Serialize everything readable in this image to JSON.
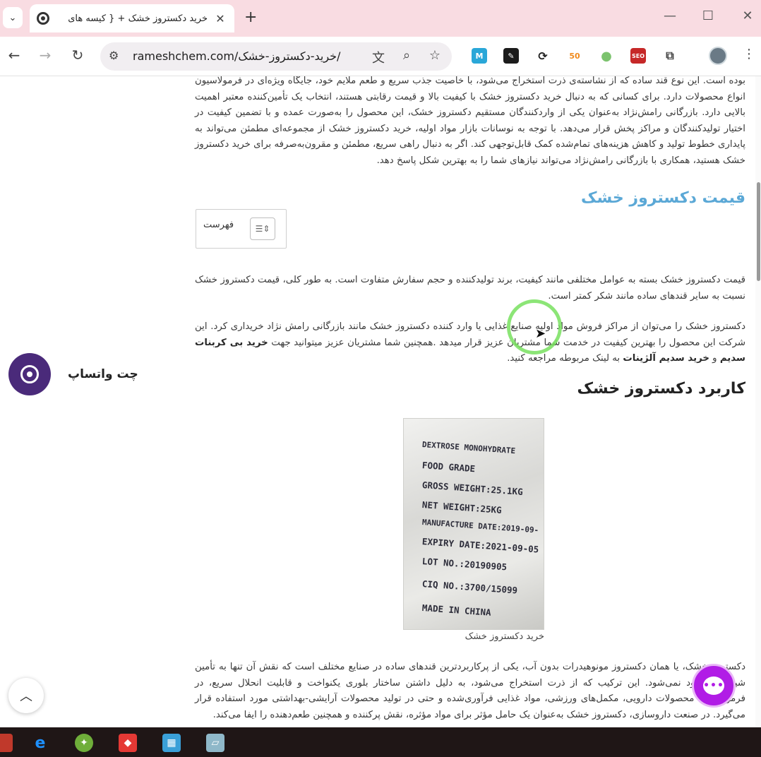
{
  "browser": {
    "tab_title": "خرید دکستروز خشک + { کیسه های",
    "tab_close": "✕",
    "new_tab": "+",
    "url": "rameshchem.com/خرید-دکستروز-خشک/",
    "window_minimize": "—",
    "window_maximize": "☐",
    "window_close": "✕"
  },
  "extensions": [
    {
      "name": "m-extension",
      "glyph": "M",
      "color": "#2aa7d8"
    },
    {
      "name": "shield-extension",
      "glyph": "✎",
      "color": "#1b1b1b"
    },
    {
      "name": "sync-extension",
      "glyph": "⟳",
      "color": "#222222"
    },
    {
      "name": "fifty-extension",
      "glyph": "50",
      "color": "#f08a1c"
    },
    {
      "name": "dot-extension",
      "glyph": "●",
      "color": "#7cc36e"
    },
    {
      "name": "seo-extension",
      "glyph": "SEO",
      "color": "#c62828"
    }
  ],
  "article": {
    "intro_paragraph": "بوده است. این نوع قند ساده که از نشاسته‌ی ذرت استخراج می‌شود، با خاصیت جذب سریع و طعم ملایم خود، جایگاه ویژه‌ای در فرمولاسیون انواع محصولات دارد. برای کسانی که به دنبال خرید دکستروز خشک با کیفیت بالا و قیمت رقابتی هستند، انتخاب یک تأمین‌کننده معتبر اهمیت بالایی دارد. بازرگانی رامش‌نژاد به‌عنوان یکی از واردکنندگان مستقیم دکستروز خشک، این محصول را به‌صورت عمده و با تضمین کیفیت در اختیار تولیدکنندگان و مراکز پخش قرار می‌دهد. با توجه به نوسانات بازار مواد اولیه، خرید دکستروز خشک از مجموعه‌ای مطمئن می‌تواند به پایداری خطوط تولید و کاهش هزینه‌های تمام‌شده کمک قابل‌توجهی کند. اگر به دنبال راهی سریع، مطمئن و مقرون‌به‌صرفه برای خرید دکستروز خشک هستید، همکاری با بازرگانی رامش‌نژاد می‌تواند نیازهای شما را به بهترین شکل پاسخ دهد.",
    "price_heading": "قیمت دکستروز خشک",
    "toc_label": "فهرست",
    "price_paragraph": "قیمت دکستروز خشک بسته به عوامل مختلفی مانند کیفیت، برند تولیدکننده و حجم سفارش متفاوت است. به طور کلی، قیمت دکستروز خشک نسبت به سایر قندهای ساده مانند شکر کمتر است.",
    "buy_paragraph_part1": "دکستروز خشک را می‌توان از مراکز فروش مواد اولیه صنایع غذایی  یا وارد کننده دکستروز خشک مانند بازرگانی رامش نژاد خریداری کرد. این شرکت این محصول را بهترین کیفیت در خدمت شما مشتریان عزیز قرار میدهد .همچنین شما مشتریان عزیز میتوانید جهت",
    "buy_link_1": "خرید بی کربنات سدیم",
    "buy_and": "و",
    "buy_link_2": "خرید سدیم آلژینات",
    "buy_paragraph_part2": "به لینک مربوطه مراجعه کنید.",
    "usage_heading": "کاربرد دکستروز خشک",
    "image_caption": "خرید دکستروز خشک",
    "usage_paragraph": "دکستروز خشک، یا همان دکستروز مونوهیدرات بدون آب، یکی از پرکاربردترین قندهای ساده در صنایع مختلف است که نقش آن تنها به تأمین شیرینی محدود نمی‌شود. این ترکیب که از ذرت استخراج می‌شود، به دلیل داشتن ساختار بلوری یکنواخت و قابلیت انحلال سریع، در فرمولاسیون محصولات دارویی، مکمل‌های ورزشی، مواد غذایی فرآوری‌شده و حتی در تولید محصولات آرایشی-بهداشتی مورد استفاده قرار می‌گیرد. در صنعت داروسازی، دکستروز خشک به‌عنوان یک حامل مؤثر برای مواد مؤثره، نقش پرکننده و همچنین طعم‌دهنده را ایفا می‌کند."
  },
  "product_bag_text": [
    "DEXTROSE MONOHYDRATE",
    "FOOD GRADE",
    "GROSS WEIGHT:25.1KG",
    "NET WEIGHT:25KG",
    "MANUFACTURE DATE:2019-09-",
    "EXPIRY DATE:2021-09-05",
    "LOT NO.:20190905",
    "CIQ NO.:3700/15099",
    "MADE IN CHINA"
  ],
  "widgets": {
    "whatsapp_label": "چت واتساپ",
    "chat_glyph": "•••",
    "scroll_top_glyph": "︿"
  }
}
